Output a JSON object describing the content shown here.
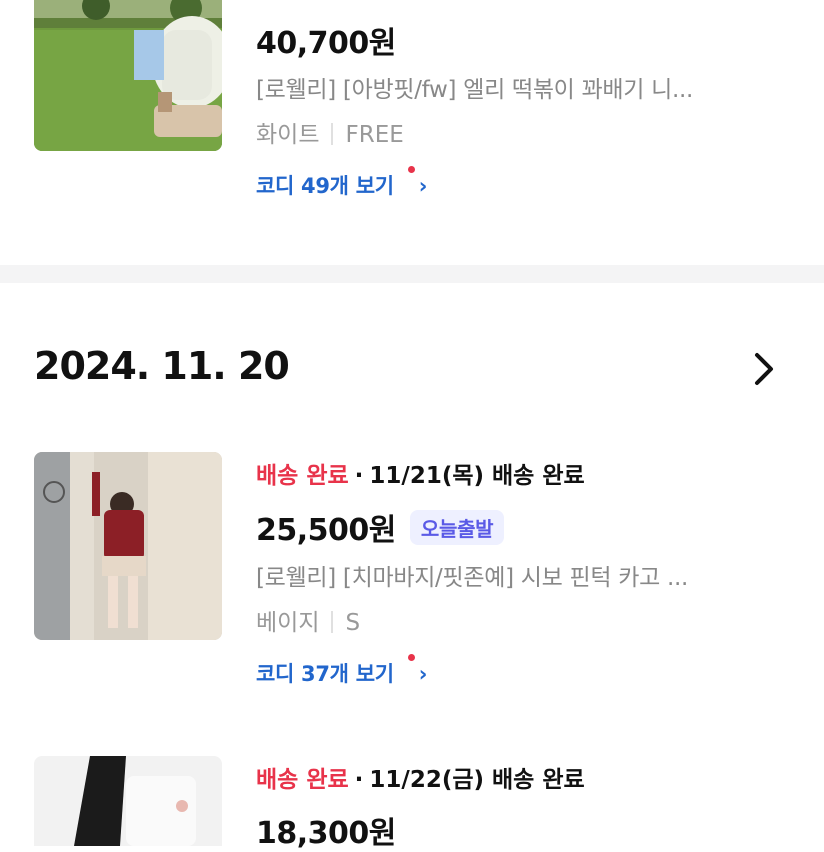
{
  "order_top": {
    "price": "40,700원",
    "title": "[로웰리] [아방핏/fw] 엘리 떡볶이 꽈배기 니...",
    "option_color": "화이트",
    "option_size": "FREE",
    "coordi_label": "코디 49개 보기",
    "chevron": "›"
  },
  "date_group": {
    "date": "2024. 11. 20",
    "chevron_icon": "chevron-right-icon"
  },
  "order_1": {
    "status": "배송 완료",
    "sep": "·",
    "delivery": "11/21(목) 배송 완료",
    "price": "25,500원",
    "badge": "오늘출발",
    "title": "[로웰리] [치마바지/핏존예] 시보 핀턱 카고 ...",
    "option_color": "베이지",
    "option_size": "S",
    "coordi_label": "코디 37개 보기",
    "chevron": "›"
  },
  "order_2": {
    "status": "배송 완료",
    "sep": "·",
    "delivery": "11/22(금) 배송 완료",
    "price": "18,300원"
  },
  "colors": {
    "status_red": "#e8334a",
    "link_blue": "#2266cc",
    "badge_bg": "#eef0ff",
    "badge_text": "#5a5ae6",
    "divider": "#f4f4f5"
  }
}
